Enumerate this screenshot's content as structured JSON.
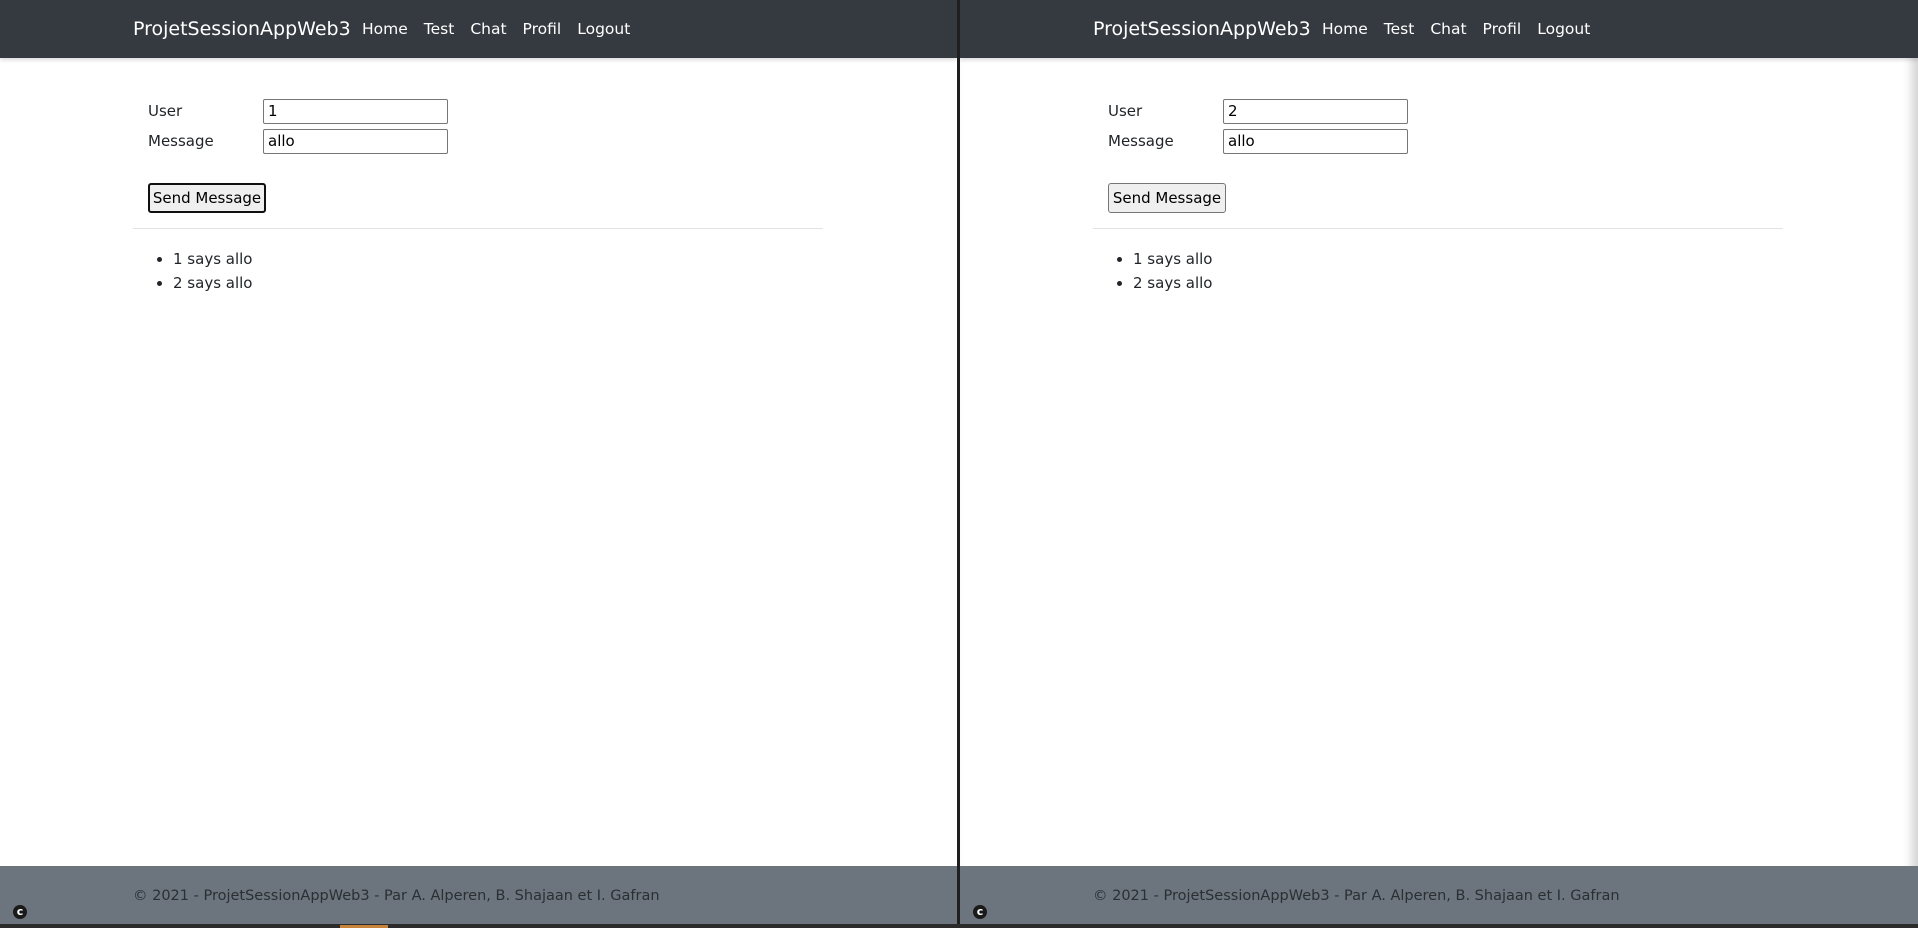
{
  "panes": [
    {
      "navbar": {
        "brand": "ProjetSessionAppWeb3",
        "links": [
          "Home",
          "Test",
          "Chat",
          "Profil",
          "Logout"
        ]
      },
      "form": {
        "user_label": "User",
        "user_value": "1",
        "message_label": "Message",
        "message_value": "allo",
        "send_label": "Send Message"
      },
      "messages": [
        "1 says allo",
        "2 says allo"
      ],
      "footer": "© 2021 - ProjetSessionAppWeb3 - Par A. Alperen, B. Shajaan et I. Gafran"
    },
    {
      "navbar": {
        "brand": "ProjetSessionAppWeb3",
        "links": [
          "Home",
          "Test",
          "Chat",
          "Profil",
          "Logout"
        ]
      },
      "form": {
        "user_label": "User",
        "user_value": "2",
        "message_label": "Message",
        "message_value": "allo",
        "send_label": "Send Message"
      },
      "messages": [
        "1 says allo",
        "2 says allo"
      ],
      "footer": "© 2021 - ProjetSessionAppWeb3 - Par A. Alperen, B. Shajaan et I. Gafran"
    }
  ],
  "corner_icon": "c-circle-icon",
  "colors": {
    "navbar": "#343a40",
    "footer": "#6c757d",
    "page_bg": "#ffffff"
  }
}
